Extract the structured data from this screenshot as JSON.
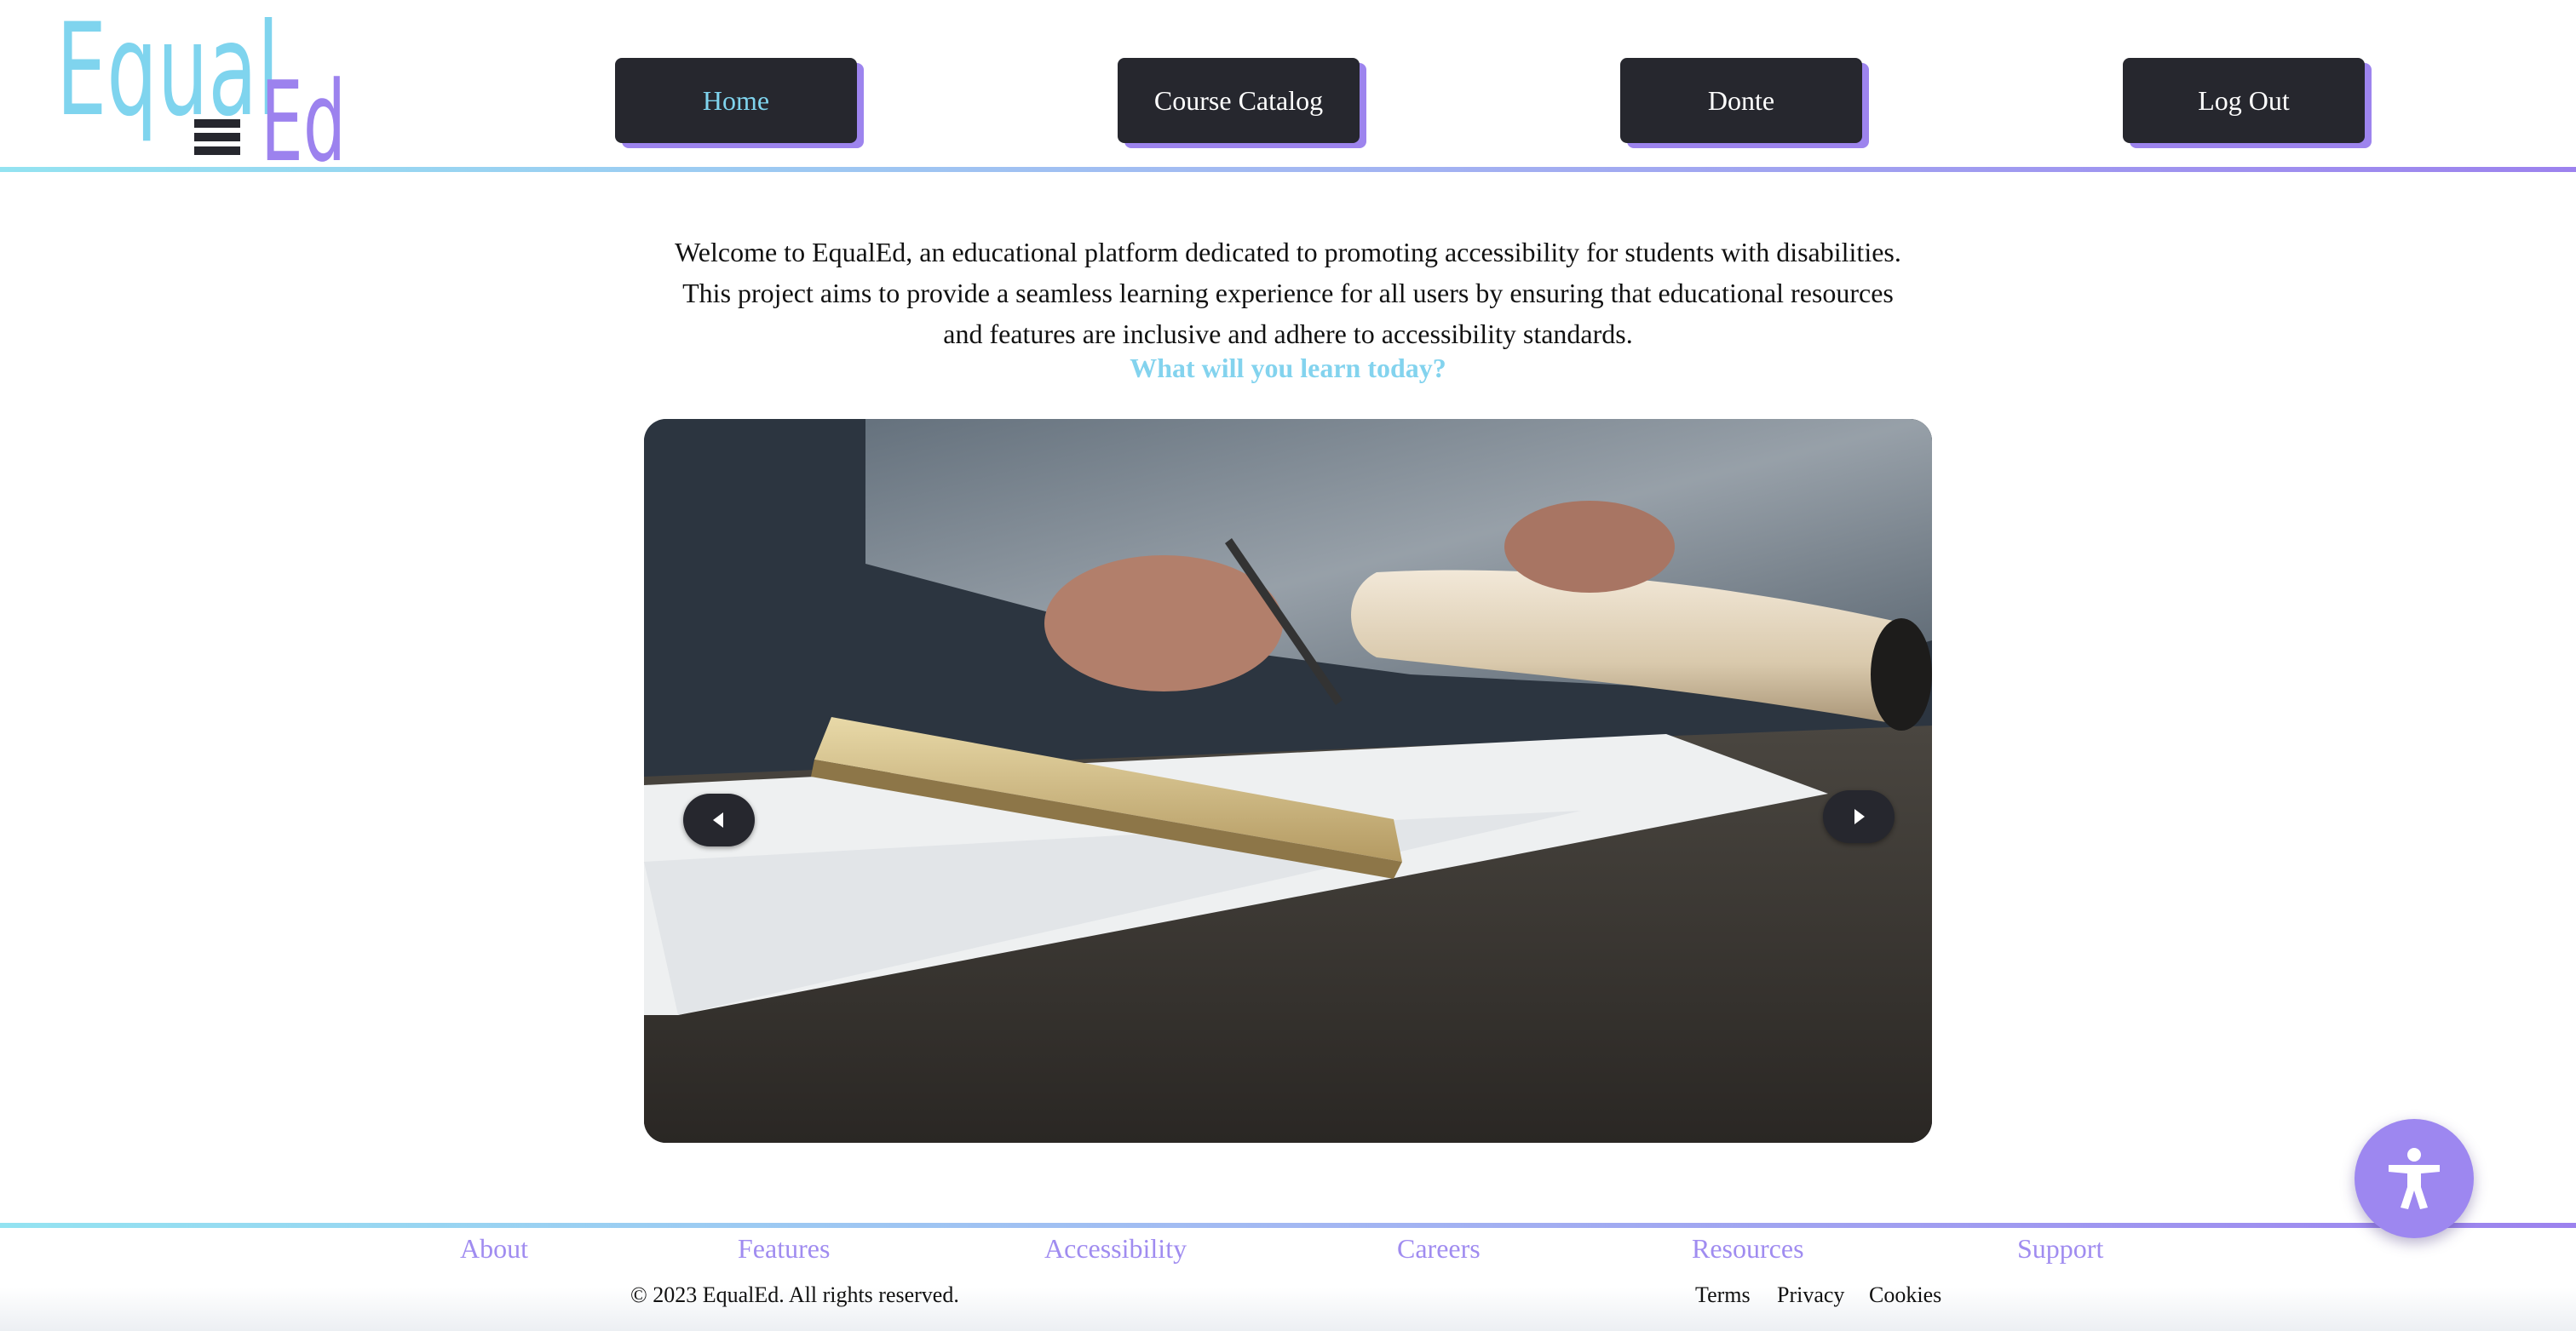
{
  "header": {
    "logo_text_top": "Equal",
    "logo_text_bottom": "Ed",
    "nav": [
      {
        "label": "Home",
        "active": true
      },
      {
        "label": "Course Catalog",
        "active": false
      },
      {
        "label": "Donte",
        "active": false
      },
      {
        "label": "Log Out",
        "active": false
      }
    ]
  },
  "main": {
    "intro": "Welcome to EqualEd, an educational platform dedicated to promoting accessibility for students with disabilities. This project aims to provide a seamless learning experience for all users by ensuring that educational resources and features are inclusive and adhere to accessibility standards.",
    "tagline": "What will you learn today?",
    "carousel": {
      "prev_icon": "triangle-left-icon",
      "next_icon": "triangle-right-icon"
    }
  },
  "footer": {
    "links": [
      "About",
      "Features",
      "Accessibility",
      "Careers",
      "Resources",
      "Support"
    ],
    "copyright": "© 2023 EqualEd. All rights reserved.",
    "legal": [
      "Terms",
      "Privacy",
      "Cookies"
    ]
  },
  "accessibility_button": {
    "icon": "accessibility-person-icon"
  },
  "colors": {
    "accent_cyan": "#83d3ee",
    "accent_purple": "#9d84ee",
    "button_dark": "#26272e"
  }
}
